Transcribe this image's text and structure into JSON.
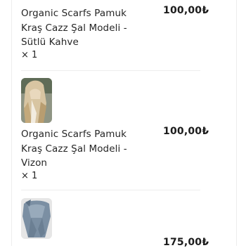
{
  "items": [
    {
      "title_lines": [
        "Organic Scarfs Pamuk",
        "Kraş Cazz Şal Modeli -",
        "Sütlü Kahve"
      ],
      "quantity": "× 1",
      "price": "100,00₺",
      "image": "scarf-photo-sutlu-kahve"
    },
    {
      "title_lines": [
        "Organic Scarfs Pamuk",
        "Kraş Cazz Şal Modeli -",
        "Vizon"
      ],
      "quantity": "× 1",
      "price": "100,00₺",
      "image": "scarf-photo-vizon"
    },
    {
      "title_lines": [],
      "quantity": "",
      "price": "175,00₺",
      "image": "scarf-photo-gray"
    }
  ],
  "colors": {
    "text": "#262626",
    "divider": "#ededed",
    "vizon_scarf": "#cdb58f",
    "gray_scarf": "#7b8fa3"
  }
}
